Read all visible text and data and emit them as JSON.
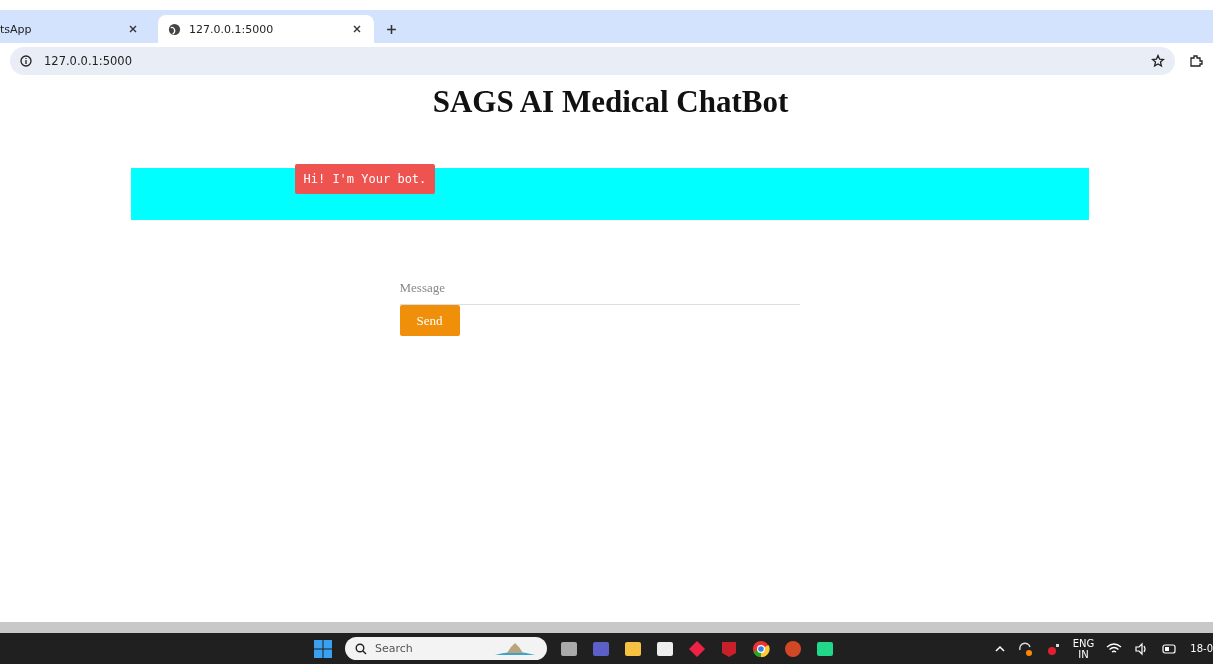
{
  "browser": {
    "tabs": [
      {
        "label": "tsApp",
        "selected": false
      },
      {
        "label": "127.0.0.1:5000",
        "selected": true
      }
    ],
    "address": "127.0.0.1:5000"
  },
  "page": {
    "title": "SAGS AI Medical ChatBot",
    "messages": [
      "Hi! I'm Your bot."
    ],
    "message_field": {
      "placeholder": "Message"
    },
    "send_button": "Send"
  },
  "taskbar": {
    "search": {
      "placeholder": "Search"
    },
    "language": [
      "ENG",
      "IN"
    ],
    "clock": "18-0"
  }
}
